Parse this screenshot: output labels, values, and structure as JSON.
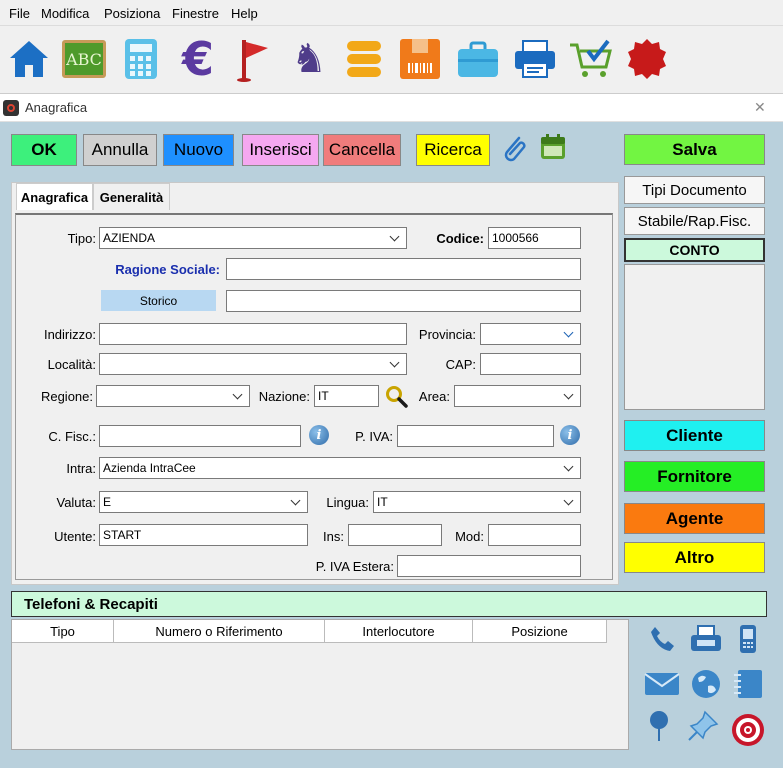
{
  "menu": [
    "File",
    "Modifica",
    "Posiziona",
    "Finestre",
    "Help"
  ],
  "toolbar_icons": [
    "home-icon",
    "abc-icon",
    "calculator-icon",
    "euro-icon",
    "flag-icon",
    "chess-knight-icon",
    "stack-icon",
    "barcode-box-icon",
    "briefcase-icon",
    "printer-icon",
    "shopping-cart-icon",
    "badge-icon"
  ],
  "toolbar_abc_text": "ABC",
  "window": {
    "title": "Anagrafica",
    "close": "✕"
  },
  "actions": {
    "ok": "OK",
    "annulla": "Annulla",
    "nuovo": "Nuovo",
    "inserisci": "Inserisci",
    "cancella": "Cancella",
    "ricerca": "Ricerca",
    "salva": "Salva"
  },
  "side": {
    "tipi_documento": "Tipi Documento",
    "stabile": "Stabile/Rap.Fisc.",
    "conto": "CONTO",
    "cliente": "Cliente",
    "fornitore": "Fornitore",
    "agente": "Agente",
    "altro": "Altro"
  },
  "tabs": [
    "Anagrafica",
    "Generalità"
  ],
  "form": {
    "tipo_label": "Tipo:",
    "tipo_value": "AZIENDA",
    "codice_label": "Codice:",
    "codice_value": "1000566",
    "ragione_label": "Ragione Sociale:",
    "ragione_value": "",
    "storico_label": "Storico",
    "storico_value": "",
    "indirizzo_label": "Indirizzo:",
    "indirizzo_value": "",
    "provincia_label": "Provincia:",
    "provincia_value": "",
    "localita_label": "Località:",
    "localita_value": "",
    "cap_label": "CAP:",
    "cap_value": "",
    "regione_label": "Regione:",
    "regione_value": "",
    "nazione_label": "Nazione:",
    "nazione_value": "IT",
    "area_label": "Area:",
    "area_value": "",
    "cfisc_label": "C. Fisc.:",
    "cfisc_value": "",
    "piva_label": "P. IVA:",
    "piva_value": "",
    "intra_label": "Intra:",
    "intra_value": "Azienda IntraCee",
    "valuta_label": "Valuta:",
    "valuta_value": "E",
    "lingua_label": "Lingua:",
    "lingua_value": "IT",
    "utente_label": "Utente:",
    "utente_value": "START",
    "ins_label": "Ins:",
    "ins_value": "",
    "mod_label": "Mod:",
    "mod_value": "",
    "piva_estera_label": "P. IVA Estera:",
    "piva_estera_value": "",
    "info_glyph": "i"
  },
  "telefoni": {
    "title": "Telefoni & Recapiti",
    "columns": [
      "Tipo",
      "Numero o Riferimento",
      "Interlocutore",
      "Posizione"
    ],
    "rows": []
  },
  "contact_icons": [
    "phone-icon",
    "fax-icon",
    "mobile-icon",
    "email-icon",
    "web-icon",
    "notes-icon",
    "map-pin-icon",
    "pushpin-icon",
    "target-icon"
  ],
  "colors": {
    "ok": "#3df07c",
    "nuovo": "#1e90ff",
    "inserisci": "#f5a8f0",
    "cancella": "#f07c7c",
    "ricerca": "#ffff00",
    "salva": "#72f542",
    "cliente": "#1ff0f0",
    "fornitore": "#25ee25",
    "agente": "#fa7a0f",
    "altro": "#ffff00",
    "conto": "#ccf9dc"
  }
}
